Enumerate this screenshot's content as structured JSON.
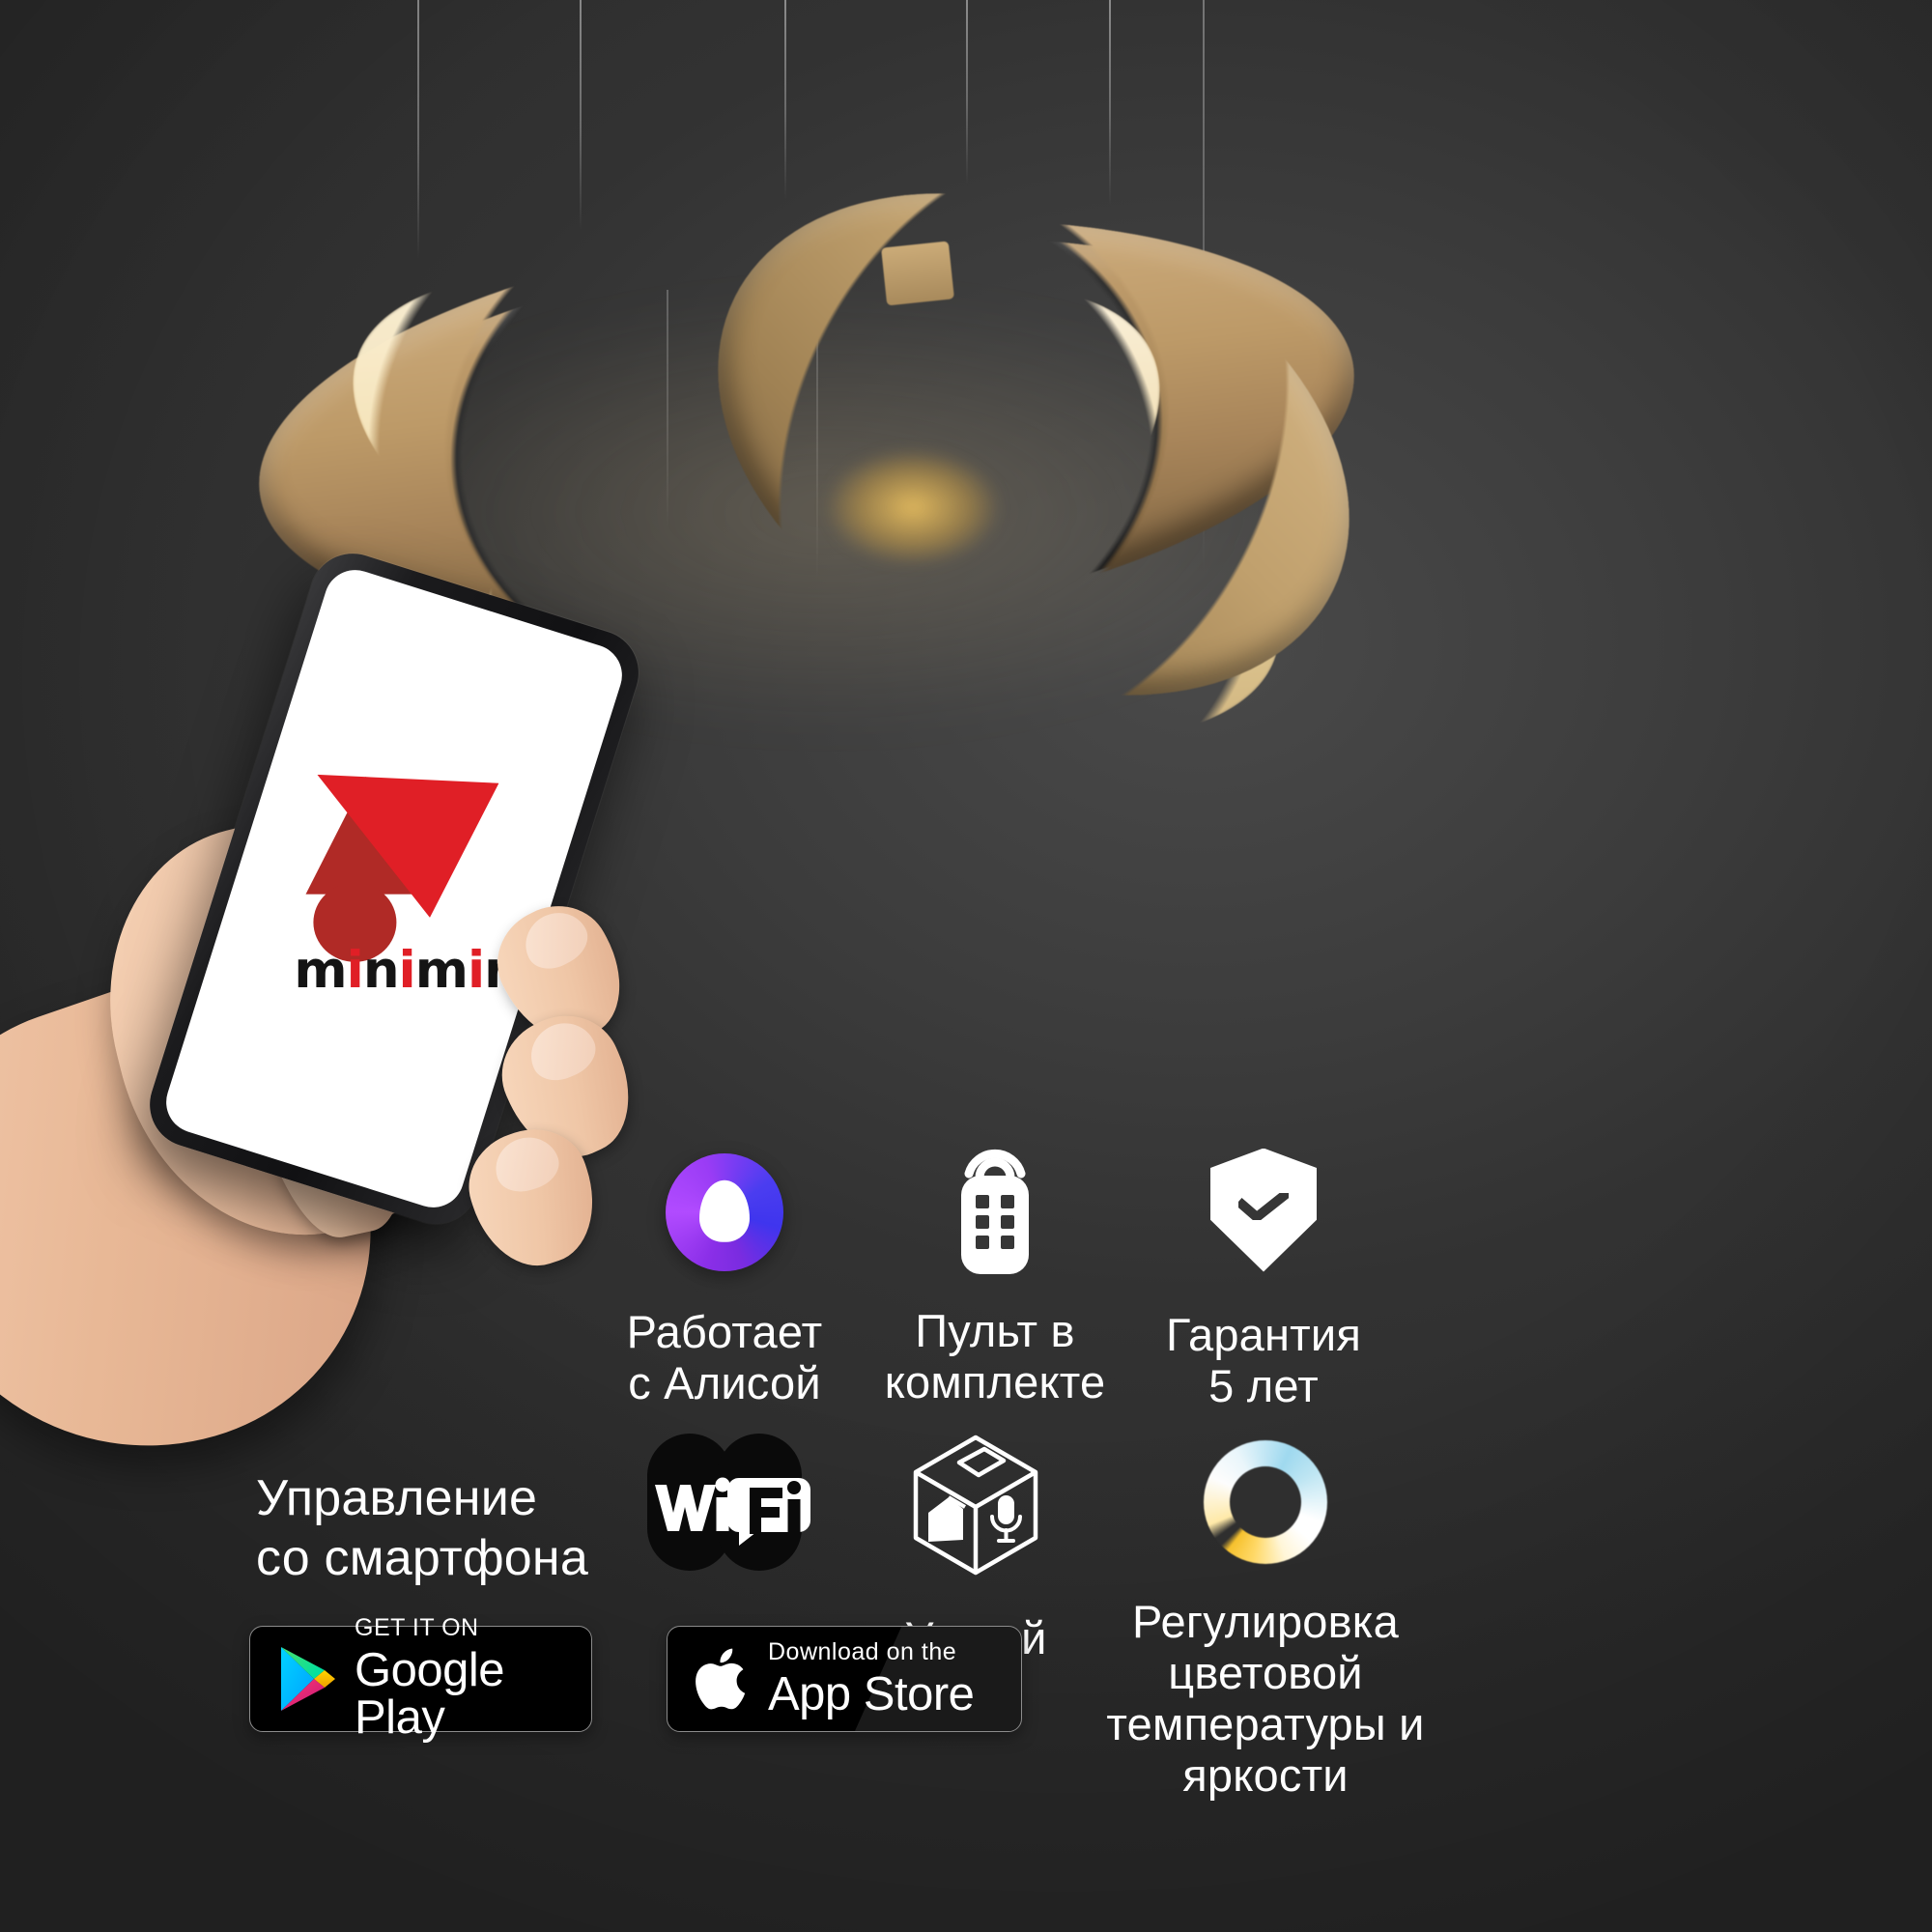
{
  "page": {
    "background_color": "#2f2f2f",
    "product": "LED ring chandelier (gold, 3 interlocking rings)"
  },
  "phone": {
    "app_logo": {
      "wordmark": "minimir",
      "wordmark_red_letters": "i",
      "brand_red": "#e01f26",
      "brand_dark_red": "#b02a26",
      "shapes": [
        "red-triangle",
        "dark-red-triangle",
        "dark-red-circle"
      ]
    }
  },
  "left_text": {
    "line": "Управление\nсо смартфона"
  },
  "features": [
    {
      "id": "alice",
      "icon": "alice-assistant-icon",
      "label": "Работает\nс Алисой",
      "colors": {
        "purple": "#8b2fe8",
        "blue": "#3f35ee"
      }
    },
    {
      "id": "remote",
      "icon": "remote-control-icon",
      "label": "Пульт в\nкомплекте",
      "colors": {
        "fill": "#ffffff",
        "buttons": "#363636"
      }
    },
    {
      "id": "warranty",
      "icon": "shield-check-icon",
      "label": "Гарантия\n5 лет",
      "colors": {
        "fill": "#ffffff"
      }
    },
    {
      "id": "wifi",
      "icon": "wifi-logo-icon",
      "label": "Wi Fi",
      "label_parts": [
        "Wi",
        "Fi"
      ],
      "colors": {
        "bg": "#0a0a0a",
        "fg": "#ffffff"
      }
    },
    {
      "id": "smart-home",
      "icon": "smart-home-cube-icon",
      "label": "Умный\nдом",
      "colors": {
        "stroke": "#ffffff"
      }
    },
    {
      "id": "color-temp",
      "icon": "color-temperature-ring-icon",
      "label": "Регулировка\nцветовой\nтемпературы и\nяркости",
      "colors": {
        "warm": "#f6c12e",
        "cool": "#9fd9ef",
        "neutral": "#ffffff"
      }
    }
  ],
  "store_badges": [
    {
      "id": "google-play",
      "icon": "google-play-triangle-icon",
      "small_text": "GET IT ON",
      "big_text": "Google Play",
      "colors": {
        "bg": "#000000",
        "border": "#8c8c8c"
      }
    },
    {
      "id": "app-store",
      "icon": "apple-logo-icon",
      "small_text": "Download on the",
      "big_text": "App Store",
      "colors": {
        "bg": "#000000",
        "border": "#8c8c8c"
      }
    }
  ]
}
